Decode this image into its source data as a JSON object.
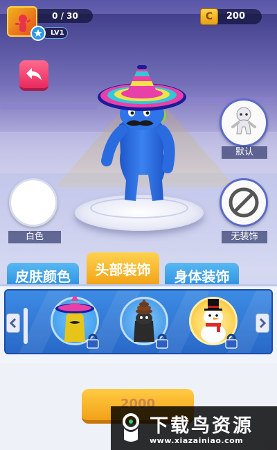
{
  "hud": {
    "progress": "0 / 30",
    "level": "LV1",
    "coins": "200"
  },
  "side_options": {
    "left": {
      "label": "白色"
    },
    "right_top": {
      "label": "默认"
    },
    "right_bottom": {
      "label": "无装饰"
    }
  },
  "tabs": [
    {
      "label": "皮肤颜色",
      "active": false
    },
    {
      "label": "头部装饰",
      "active": true
    },
    {
      "label": "身体装饰",
      "active": false
    }
  ],
  "items": [
    {
      "name": "sombrero-hat",
      "locked": true,
      "selected": true
    },
    {
      "name": "poop-hat",
      "locked": true,
      "selected": false
    },
    {
      "name": "snowman-hat",
      "locked": true,
      "selected": false
    }
  ],
  "buy_button": {
    "label": "2000"
  },
  "watermark": {
    "title": "下载鸟资源",
    "url": "www.xiazainiao.com"
  },
  "colors": {
    "character": "#2a6fe0",
    "tab_active": "#f5b12a",
    "tab_inactive": "#3aa0ea",
    "back_button": "#f0406e"
  }
}
